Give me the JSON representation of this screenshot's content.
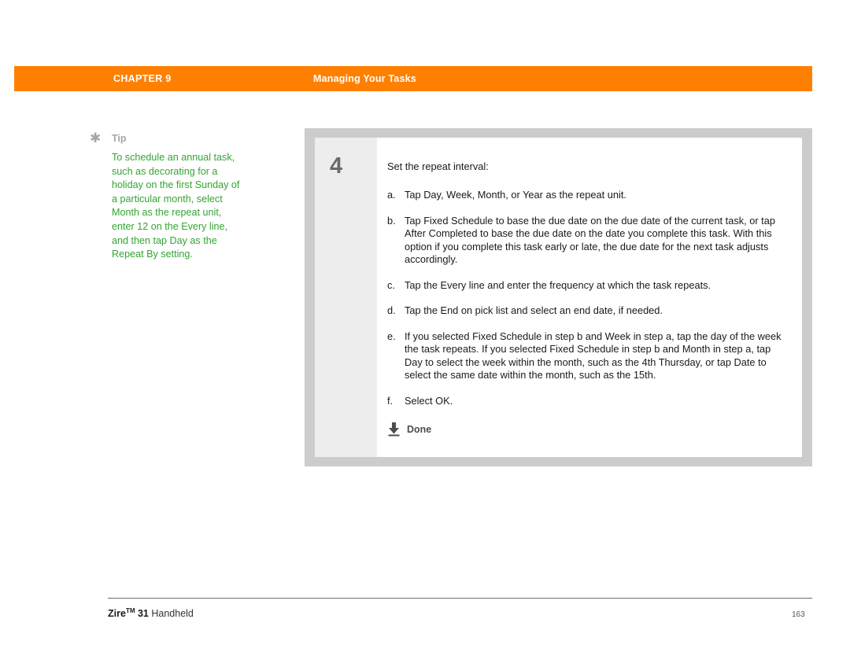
{
  "header": {
    "chapter": "CHAPTER 9",
    "section": "Managing Your Tasks",
    "bar_color": "#ff8000",
    "text_color": "#ffffff"
  },
  "tip": {
    "icon": "asterisk-icon",
    "icon_glyph": "✱",
    "label": "Tip",
    "label_color": "#a6a6a6",
    "body": "To schedule an annual task, such as decorating for a holiday on the first Sunday of a particular month, select Month as the repeat unit, enter 12 on the Every line, and then tap Day as the Repeat By setting.",
    "body_color": "#32a532"
  },
  "step": {
    "number": "4",
    "intro": "Set the repeat interval:",
    "frame_color": "#cccccc",
    "numcol_color": "#ededed",
    "items": [
      {
        "marker": "a.",
        "text": "Tap Day, Week, Month, or Year as the repeat unit."
      },
      {
        "marker": "b.",
        "text": "Tap Fixed Schedule to base the due date on the due date of the current task, or tap After Completed to base the due date on the date you complete this task. With this option if you complete this task early or late, the due date for the next task adjusts accordingly."
      },
      {
        "marker": "c.",
        "text": "Tap the Every line and enter the frequency at which the task repeats."
      },
      {
        "marker": "d.",
        "text": "Tap the End on pick list and select an end date, if needed."
      },
      {
        "marker": "e.",
        "text": "If you selected Fixed Schedule in step b and Week in step a, tap the day of the week the task repeats. If you selected Fixed Schedule in step b and Month in step a, tap Day to select the week within the month, such as the 4th Thursday, or tap Date to select the same date within the month, such as the 15th."
      },
      {
        "marker": "f.",
        "text": "Select OK."
      }
    ],
    "done": {
      "icon": "download-arrow-icon",
      "label": "Done"
    }
  },
  "footer": {
    "brand": "Zire",
    "trademark": "TM",
    "model": " 31",
    "product": " Handheld",
    "page_number": "163"
  }
}
